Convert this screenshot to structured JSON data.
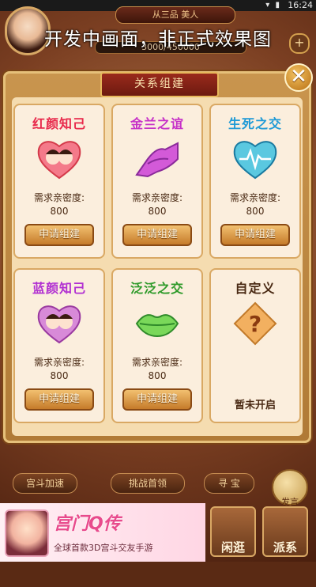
{
  "status_bar": {
    "time": "16:24",
    "icons": "▾ ▮"
  },
  "profile": {
    "rank_text": "从三品  美人",
    "exp_text": "3000/450000",
    "plus": "+"
  },
  "watermark": "开发中画面，非正式效果图",
  "modal": {
    "title": "关系组建",
    "close": "✕",
    "cards": [
      {
        "title": "红颜知己",
        "title_color": "#e8284a",
        "label": "需求亲密度:",
        "value": "800",
        "button": "申请组建"
      },
      {
        "title": "金兰之谊",
        "title_color": "#c62fc8",
        "label": "需求亲密度:",
        "value": "800",
        "button": "申请组建"
      },
      {
        "title": "生死之交",
        "title_color": "#1f9ad6",
        "label": "需求亲密度:",
        "value": "800",
        "button": "申请组建"
      },
      {
        "title": "蓝颜知己",
        "title_color": "#b12fd2",
        "label": "需求亲密度:",
        "value": "800",
        "button": "申请组建"
      },
      {
        "title": "泛泛之交",
        "title_color": "#2f9a2a",
        "label": "需求亲密度:",
        "value": "800",
        "button": "申请组建"
      },
      {
        "title": "自定义",
        "title_color": "#4a2a14",
        "status": "暂未开启"
      }
    ]
  },
  "bottom": {
    "gongdou": "宫斗加速",
    "challenge": "挑战首领",
    "seek": "寻 宝",
    "speak": "发言",
    "stroll": "闲逛",
    "faction": "派系"
  },
  "ad": {
    "title": "宫门Q传",
    "subtitle": "全球首款3D宫斗交友手游"
  }
}
